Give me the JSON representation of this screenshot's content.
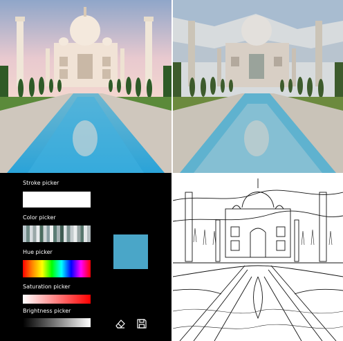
{
  "panels": {
    "original": "original-photo",
    "posterized": "posterized-photo",
    "edges": "edge-detection-image"
  },
  "controls": {
    "stroke_label": "Stroke picker",
    "color_label": "Color picker",
    "hue_label": "Hue picker",
    "saturation_label": "Saturation picker",
    "brightness_label": "Brightness picker",
    "selected_color": "#4aa6c8",
    "stroke_color": "#ffffff",
    "palette": [
      "#b9c6cc",
      "#6f8a86",
      "#d8dde0",
      "#9aa8a8",
      "#e9ecee",
      "#4a6b5e",
      "#cfd6d8",
      "#8aa0a4",
      "#f2f2f2",
      "#5b7c74",
      "#a8b4b6",
      "#3e5c52",
      "#dfe4e6",
      "#7b9290",
      "#c4ccce",
      "#eceeef",
      "#98a6a6",
      "#56766c",
      "#e3e7e8",
      "#b2bcbe"
    ],
    "icons": {
      "eraser": "eraser-icon",
      "save": "save-icon"
    }
  }
}
